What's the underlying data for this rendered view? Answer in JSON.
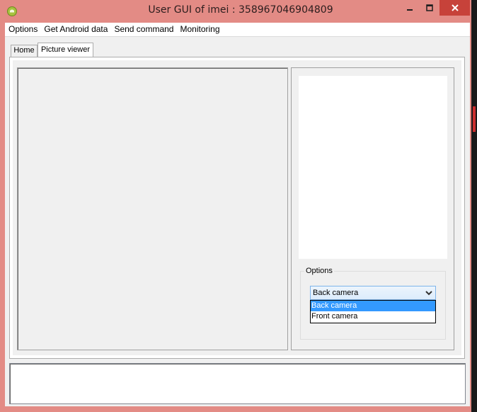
{
  "window": {
    "title": "User GUI of imei : 358967046904809",
    "titlebar_color": "#e38b85",
    "close_button_color": "#c7423a",
    "minimize_icon": "minimize-icon",
    "maximize_icon": "maximize-icon",
    "close_icon": "close-icon",
    "app_icon": "android-app-icon"
  },
  "menu": {
    "items": [
      {
        "label": "Options"
      },
      {
        "label": "Get Android data"
      },
      {
        "label": "Send command"
      },
      {
        "label": "Monitoring"
      }
    ]
  },
  "tabs": {
    "items": [
      {
        "label": "Home",
        "selected": false
      },
      {
        "label": "Picture viewer",
        "selected": true
      }
    ]
  },
  "picture_viewer": {
    "options_group_label": "Options",
    "camera_select": {
      "selected": "Back camera",
      "options": [
        "Back camera",
        "Front camera"
      ],
      "expanded": true,
      "highlight_color": "#3399ff"
    }
  }
}
